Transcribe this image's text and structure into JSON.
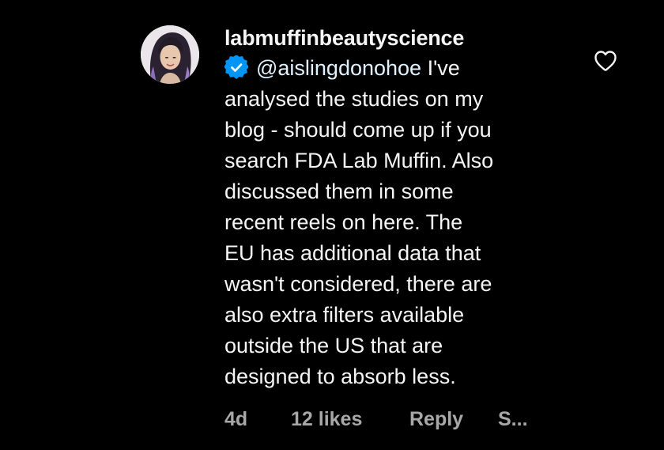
{
  "comment": {
    "username": "labmuffinbeautyscience",
    "mention": "@aislingdonohoe",
    "lines": [
      " I've",
      "analysed the studies on my",
      "blog - should come up if you",
      "search FDA Lab Muffin. Also",
      "discussed them in some",
      "recent reels on here. The",
      "EU has additional data that",
      "wasn't considered, there are",
      "also extra filters available",
      "outside the US that are",
      "designed to absorb less."
    ],
    "meta": {
      "time": "4d",
      "likes": "12 likes",
      "reply": "Reply",
      "more": "S..."
    },
    "icons": {
      "verified": "verified-badge-icon",
      "like": "heart-outline-icon",
      "avatar": "profile-photo"
    },
    "colors": {
      "background": "#000000",
      "text": "#f5f5f5",
      "secondary": "#a8a8a8",
      "verified": "#0095f6"
    }
  }
}
